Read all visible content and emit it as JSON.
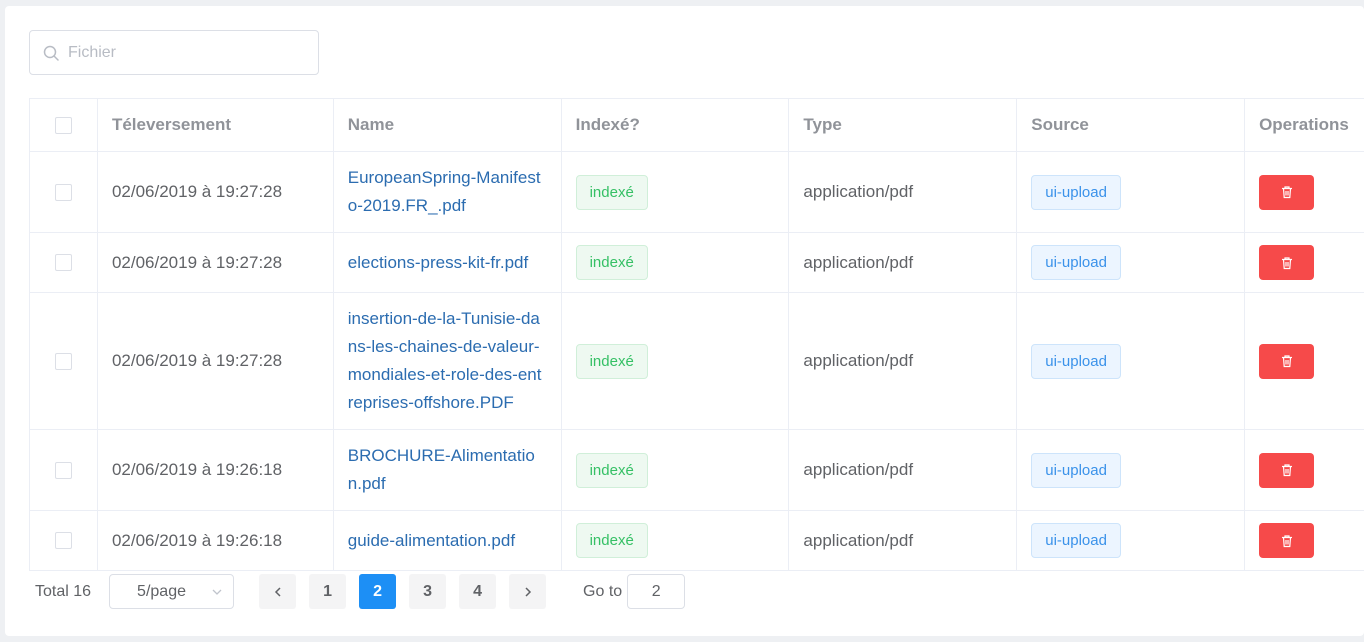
{
  "search": {
    "placeholder": "Fichier",
    "value": ""
  },
  "table": {
    "headers": [
      "Téleversement",
      "Name",
      "Indexé?",
      "Type",
      "Source",
      "Operations"
    ],
    "rows": [
      {
        "uploaded": "02/06/2019 à 19:27:28",
        "name": "EuropeanSpring-Manifesto-2019.FR_.pdf",
        "indexed": "indexé",
        "type": "application/pdf",
        "source": "ui-upload"
      },
      {
        "uploaded": "02/06/2019 à 19:27:28",
        "name": "elections-press-kit-fr.pdf",
        "indexed": "indexé",
        "type": "application/pdf",
        "source": "ui-upload"
      },
      {
        "uploaded": "02/06/2019 à 19:27:28",
        "name": "insertion-de-la-Tunisie-dans-les-chaines-de-valeur-mondiales-et-role-des-entreprises-offshore.PDF",
        "indexed": "indexé",
        "type": "application/pdf",
        "source": "ui-upload"
      },
      {
        "uploaded": "02/06/2019 à 19:26:18",
        "name": "BROCHURE-Alimentation.pdf",
        "indexed": "indexé",
        "type": "application/pdf",
        "source": "ui-upload"
      },
      {
        "uploaded": "02/06/2019 à 19:26:18",
        "name": "guide-alimentation.pdf",
        "indexed": "indexé",
        "type": "application/pdf",
        "source": "ui-upload"
      }
    ]
  },
  "pagination": {
    "total_label": "Total 16",
    "page_size": "5/page",
    "pages": [
      "1",
      "2",
      "3",
      "4"
    ],
    "current_page": "2",
    "goto_label": "Go to",
    "goto_value": "2"
  },
  "colors": {
    "primary": "#1d8ff5",
    "danger": "#f64a4a",
    "success": "#35c065",
    "link": "#2b6cb0"
  }
}
